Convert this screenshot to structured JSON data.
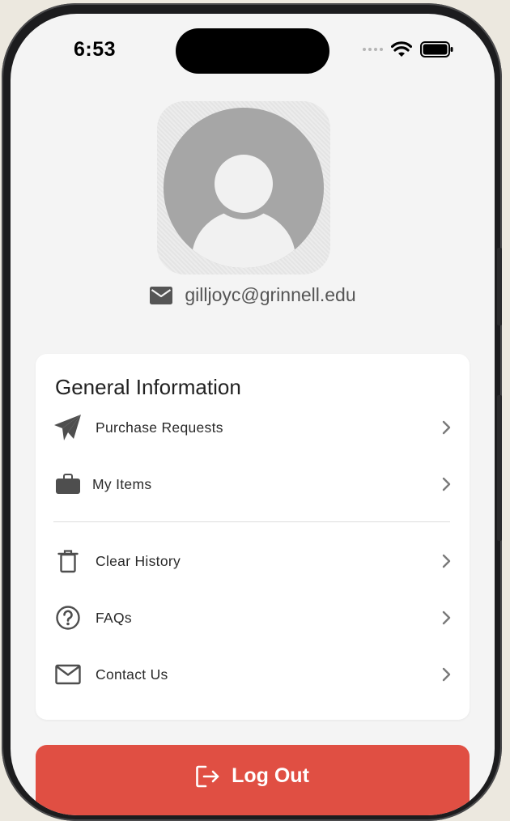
{
  "status_bar": {
    "time": "6:53"
  },
  "profile": {
    "email": "gilljoyc@grinnell.edu"
  },
  "general_info": {
    "title": "General Information",
    "items": [
      {
        "label": "Purchase Requests",
        "icon": "paper-plane-icon"
      },
      {
        "label": "My Items",
        "icon": "briefcase-icon"
      }
    ],
    "secondary_items": [
      {
        "label": "Clear History",
        "icon": "trash-icon"
      },
      {
        "label": "FAQs",
        "icon": "question-circle-icon"
      },
      {
        "label": "Contact Us",
        "icon": "envelope-outline-icon"
      }
    ]
  },
  "logout": {
    "label": "Log Out"
  },
  "colors": {
    "accent": "#e04f43",
    "background": "#f4f4f4",
    "card": "#ffffff"
  }
}
